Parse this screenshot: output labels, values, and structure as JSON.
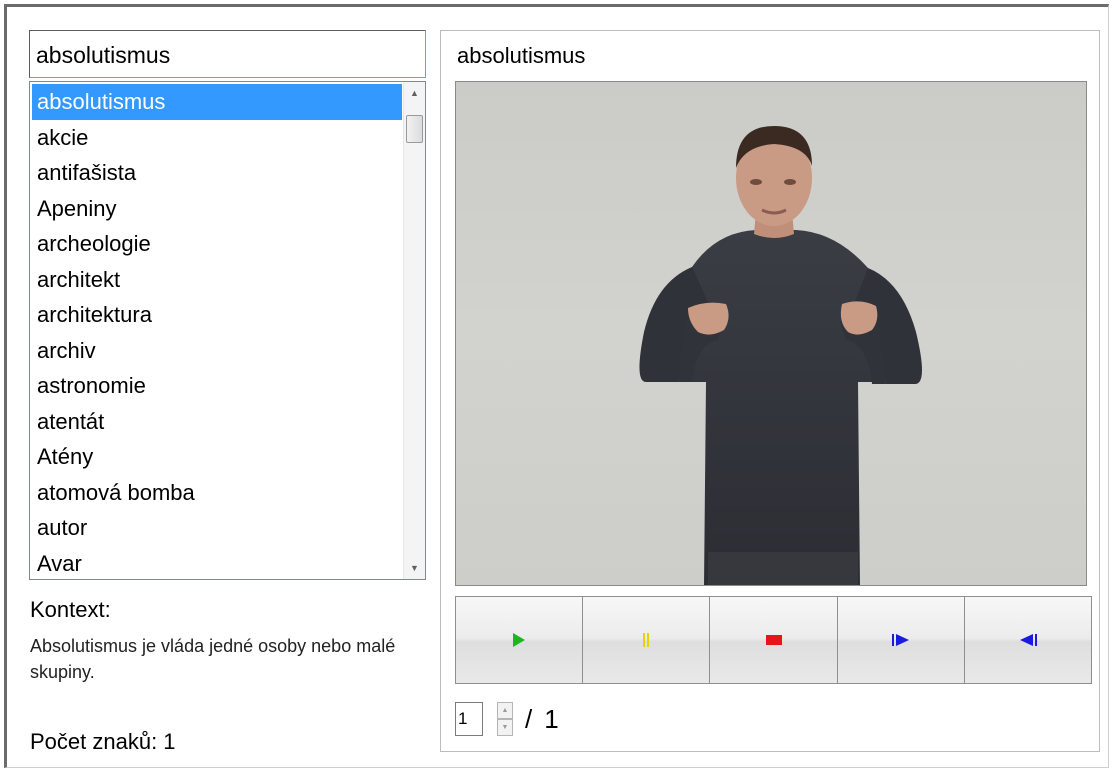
{
  "search": {
    "value": "absolutismus"
  },
  "word_list": {
    "items": [
      {
        "label": "absolutismus",
        "selected": true
      },
      {
        "label": "akcie",
        "selected": false
      },
      {
        "label": "antifašista",
        "selected": false
      },
      {
        "label": "Apeniny",
        "selected": false
      },
      {
        "label": "archeologie",
        "selected": false
      },
      {
        "label": "architekt",
        "selected": false
      },
      {
        "label": "architektura",
        "selected": false
      },
      {
        "label": "archiv",
        "selected": false
      },
      {
        "label": "astronomie",
        "selected": false
      },
      {
        "label": "atentát",
        "selected": false
      },
      {
        "label": "Atény",
        "selected": false
      },
      {
        "label": "atomová bomba",
        "selected": false
      },
      {
        "label": "autor",
        "selected": false
      },
      {
        "label": "Avar",
        "selected": false
      }
    ]
  },
  "context": {
    "title": "Kontext:",
    "text": "Absolutismus je vláda jedné osoby nebo malé skupiny."
  },
  "sign_count": "Počet znaků: 1",
  "video": {
    "title": "absolutismus"
  },
  "controls": {
    "play_icon": "play-icon",
    "play_color": "#22b322",
    "pause_icon": "pause-icon",
    "pause_color": "#e6d400",
    "stop_icon": "stop-icon",
    "stop_color": "#e8141a",
    "step_forward_icon": "step-forward-icon",
    "step_forward_color": "#1a1ae0",
    "step_back_icon": "step-back-icon",
    "step_back_color": "#1a1ae0"
  },
  "pager": {
    "current": "1",
    "separator": "/",
    "total": "1"
  },
  "colors": {
    "selection": "#3399ff"
  }
}
